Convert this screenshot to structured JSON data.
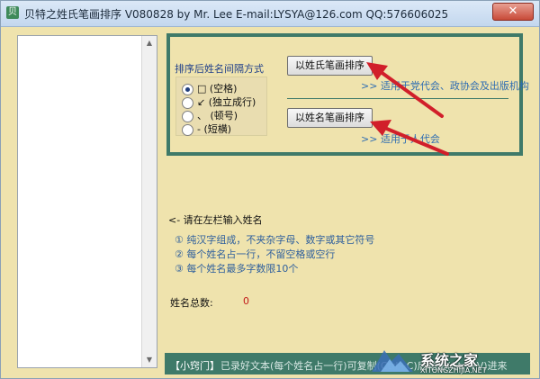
{
  "window": {
    "title": "贝特之姓氏笔画排序   V080828   by Mr. Lee   E-mail:LYSYA@126.com   QQ:576606025",
    "close_glyph": "✕"
  },
  "options": {
    "separator_label": "排序后姓名间隔方式",
    "separator_options": [
      {
        "label": "□ (空格)",
        "checked": true
      },
      {
        "label": "↙ (独立成行)",
        "checked": false
      },
      {
        "label": "、 (顿号)",
        "checked": false
      },
      {
        "label": "- (短横)",
        "checked": false
      }
    ],
    "sort_by_surname_label": "以姓氏笔画排序",
    "sort_by_surname_note": ">> 适用于党代会、政协会及出版机构",
    "sort_by_name_label": "以姓名笔画排序",
    "sort_by_name_note": ">> 适用于人代会"
  },
  "instructions": {
    "prompt": "<- 请在左栏输入姓名",
    "rules": [
      "① 纯汉字组成，不夹杂字母、数字或其它符号",
      "② 每个姓名占一行，不留空格或空行",
      "③ 每个姓名最多字数限10个"
    ]
  },
  "stats": {
    "total_label": "姓名总数:",
    "total_value": "0"
  },
  "footer": {
    "title": "【小窍门】",
    "text": "已录好文本(每个姓名占一行)可复制(Ctrl+C)后粘贴(Ctrl+V)进来"
  },
  "watermark": {
    "text": "系统之家",
    "url": "XITONGZHIJIA.NET"
  },
  "colors": {
    "panel_border": "#3f7a69",
    "background": "#efe3ad",
    "arrow": "#d11f2a"
  }
}
